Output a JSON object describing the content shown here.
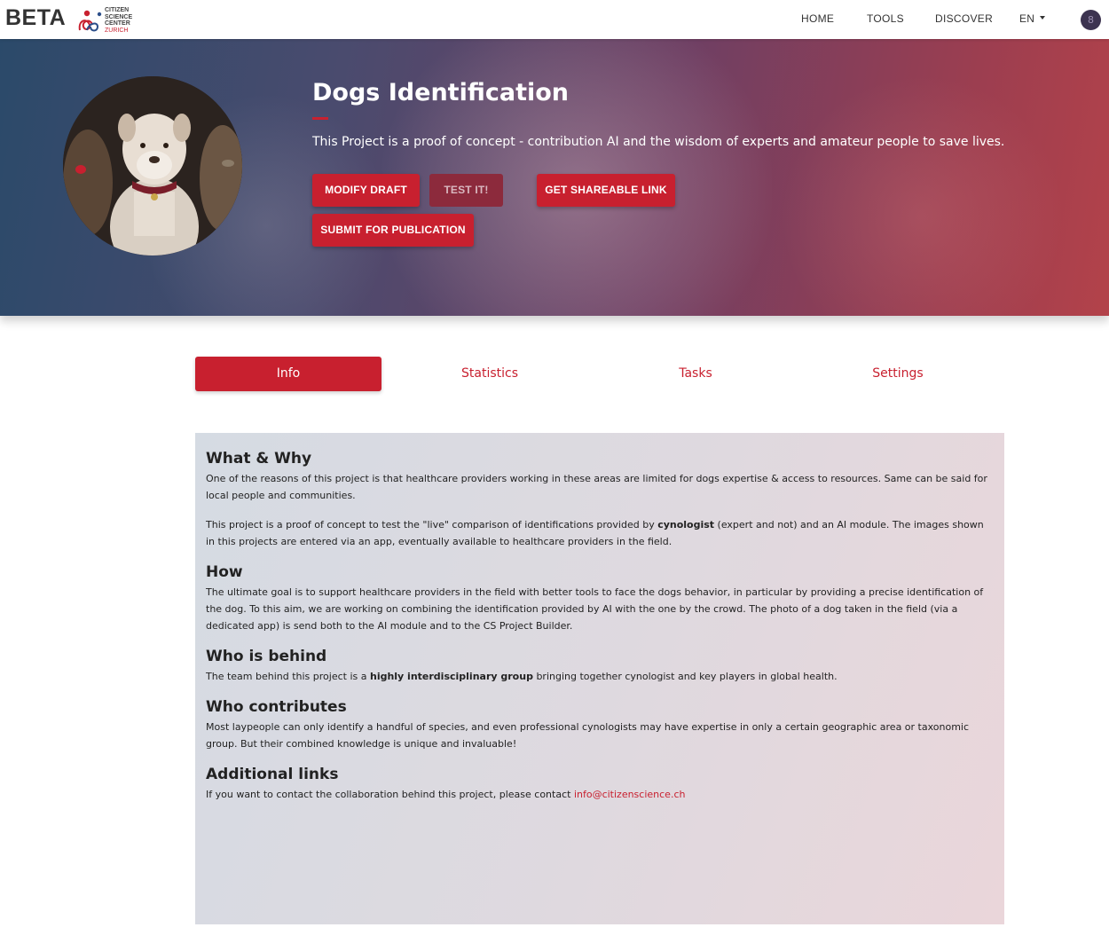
{
  "nav": {
    "brand": "BETA",
    "logo": {
      "line1": "CITIZEN",
      "line2": "SCIENCE",
      "line3": "CENTER",
      "line4": "ZURICH"
    },
    "links": [
      "HOME",
      "TOOLS",
      "DISCOVER"
    ],
    "language": "EN",
    "avatar_initial": "8"
  },
  "hero": {
    "title": "Dogs Identification",
    "description": "This Project is a proof of concept - contribution AI and the wisdom of experts and amateur people to save lives.",
    "buttons": {
      "modify": "MODIFY DRAFT",
      "test": "TEST IT!",
      "share": "GET SHAREABLE LINK",
      "submit": "SUBMIT FOR PUBLICATION"
    }
  },
  "tabs": [
    "Info",
    "Statistics",
    "Tasks",
    "Settings"
  ],
  "info": {
    "what_title": "What & Why",
    "what_p1": "One of the reasons of this project is that healthcare providers working in these areas are limited for dogs expertise & access to resources. Same can be said for local people and communities.",
    "what_p2_a": "This project is a proof of concept to test the \"live\" comparison of identifications provided by ",
    "what_p2_bold": "cynologist",
    "what_p2_b": " (expert and not) and an AI module. The images shown in this projects are entered via an app, eventually available to healthcare providers in the field.",
    "how_title": "How",
    "how_p": "The ultimate goal is to support healthcare providers in the field with better tools to face the dogs behavior, in particular by providing a precise identification of the dog. To this aim, we are working on combining the identification provided by AI with the one by the crowd. The photo of a dog taken in the field (via a dedicated app) is send both to the AI module and to the CS Project Builder.",
    "who_title": "Who is behind",
    "who_p_a": "The team behind this project is a ",
    "who_p_bold": "highly interdisciplinary group",
    "who_p_b": " bringing together cynologist and key players in global health.",
    "contrib_title": "Who contributes",
    "contrib_p": "Most laypeople can only identify a handful of species, and even professional cynologists may have expertise in only a certain geographic area or taxonomic group. But their combined knowledge is unique and invaluable!",
    "links_title": "Additional links",
    "links_p": "If you want to contact the collaboration behind this project, please contact ",
    "links_email": "info@citizenscience.ch"
  },
  "colors": {
    "accent": "#c8202f",
    "nav_bg": "#ffffff"
  },
  "icons": {
    "logo": "citizen-science-logo",
    "avatar": "user-avatar",
    "lang": "caret-down-icon"
  }
}
